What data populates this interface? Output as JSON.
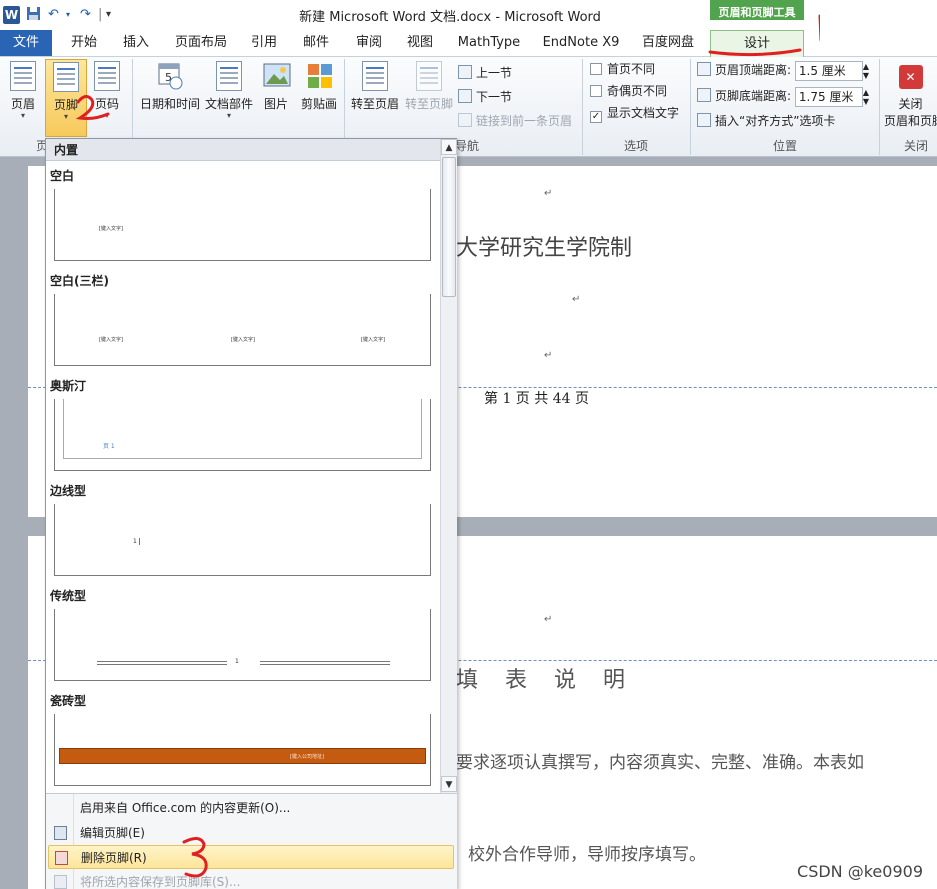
{
  "titlebar": {
    "word_icon": "W",
    "title": "新建 Microsoft Word 文档.docx  -  Microsoft Word",
    "context_group": "页眉和页脚工具"
  },
  "tabs": [
    "文件",
    "开始",
    "插入",
    "页面布局",
    "引用",
    "邮件",
    "审阅",
    "视图",
    "MathType",
    "EndNote X9",
    "百度网盘",
    "设计"
  ],
  "ribbon": {
    "header_footer": {
      "header": "页眉",
      "footer": "页脚",
      "page_number": "页码",
      "group": "页"
    },
    "insert": {
      "date_time": "日期和时间",
      "quick_parts": "文档部件",
      "picture": "图片",
      "clip_art": "剪贴画"
    },
    "navigation": {
      "goto_header": "转至页眉",
      "goto_footer": "转至页脚",
      "previous": "上一节",
      "next": "下一节",
      "link_previous": "链接到前一条页眉",
      "group": "导航"
    },
    "options": {
      "first_page": "首页不同",
      "odd_even": "奇偶页不同",
      "show_text": "显示文档文字",
      "group": "选项"
    },
    "position": {
      "header_top": "页眉顶端距离:",
      "header_top_value": "1.5 厘米",
      "footer_bottom": "页脚底端距离:",
      "footer_bottom_value": "1.75 厘米",
      "insert_tab": "插入“对齐方式”选项卡",
      "group": "位置"
    },
    "close": {
      "label1": "关闭",
      "label2": "页眉和页脚",
      "group": "关闭"
    }
  },
  "gallery": {
    "header": "内置",
    "placeholder": "[键入文字]",
    "items": [
      {
        "name": "空白"
      },
      {
        "name": "空白(三栏)"
      },
      {
        "name": "奥斯汀",
        "page_num": "页 1"
      },
      {
        "name": "边线型",
        "page_num": "1"
      },
      {
        "name": "传统型",
        "page_num": "1"
      },
      {
        "name": "瓷砖型",
        "placeholder": "[键入公司地址]"
      }
    ],
    "menu": [
      {
        "label": "启用来自 Office.com 的内容更新(O)..."
      },
      {
        "label": "编辑页脚(E)"
      },
      {
        "label": "删除页脚(R)"
      },
      {
        "label": "将所选内容保存到页脚库(S)..."
      }
    ]
  },
  "document": {
    "page1_heading": "大学研究生学院制",
    "page1_footer": "第 1 页 共 44 页",
    "page2_heading": "填 表 说 明",
    "page2_line1": "要求逐项认真撰写，内容须真实、完整、准确。本表如",
    "page2_line2": "校外合作导师，导师按序填写。",
    "para_mark": "↵"
  },
  "annotations": [
    "1",
    "2",
    "3"
  ],
  "watermark": "CSDN @ke0909",
  "colors": {
    "file_tab": "#2a64b5",
    "context_green": "#52a34d",
    "annotation_red": "#e02020",
    "highlight": "#fde59a"
  }
}
